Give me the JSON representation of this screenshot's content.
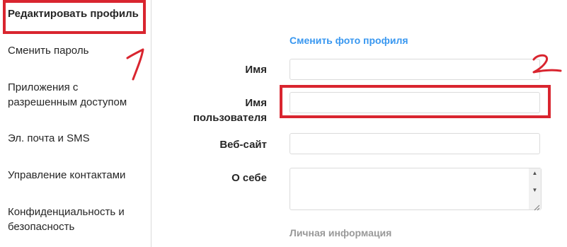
{
  "sidebar": {
    "items": [
      {
        "label": "Редактировать профиль",
        "active": true
      },
      {
        "label": "Сменить пароль"
      },
      {
        "label": "Приложения с разрешенным доступом"
      },
      {
        "label": "Эл. почта и SMS"
      },
      {
        "label": "Управление контактами"
      },
      {
        "label": "Конфиденциальность и безопасность"
      }
    ]
  },
  "form": {
    "change_photo_link": "Сменить фото профиля",
    "name_label": "Имя",
    "name_value": "",
    "username_label": "Имя пользователя",
    "username_value": "",
    "website_label": "Веб-сайт",
    "website_value": "",
    "bio_label": "О себе",
    "bio_value": "",
    "personal_info_title": "Личная информация"
  },
  "annotations": {
    "marker_1": "1",
    "marker_2": "2",
    "color": "#d9252f"
  },
  "colors": {
    "link": "#3897f0",
    "border": "#dbdbdb",
    "muted": "#999999",
    "text": "#262626"
  },
  "icons": {
    "scroll_up": "scroll-up-arrow-icon",
    "scroll_down": "scroll-down-arrow-icon",
    "resize": "resize-grip-icon"
  }
}
